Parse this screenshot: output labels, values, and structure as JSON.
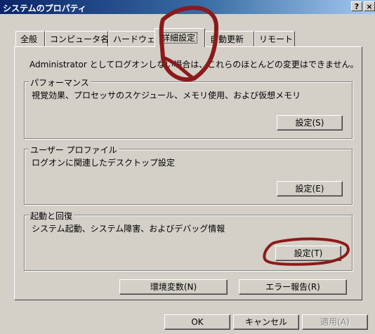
{
  "window": {
    "title": "システムのプロパティ",
    "help_label": "?",
    "close_label": "×"
  },
  "tabs": [
    {
      "label": "全般",
      "active": false
    },
    {
      "label": "コンピュータ名",
      "active": false
    },
    {
      "label": "ハードウェア",
      "active": false
    },
    {
      "label": "詳細設定",
      "active": true
    },
    {
      "label": "自動更新",
      "active": false
    },
    {
      "label": "リモート",
      "active": false
    }
  ],
  "notice": "Administrator としてログオンしない場合は、これらのほとんどの変更はできません。",
  "groups": {
    "performance": {
      "title": "パフォーマンス",
      "description": "視覚効果、プロセッサのスケジュール、メモリ使用、および仮想メモリ",
      "button_label": "設定(S)"
    },
    "user_profile": {
      "title": "ユーザー プロファイル",
      "description": "ログオンに関連したデスクトップ設定",
      "button_label": "設定(E)"
    },
    "startup_recovery": {
      "title": "起動と回復",
      "description": "システム起動、システム障害、およびデバッグ情報",
      "button_label": "設定(T)"
    }
  },
  "buttons": {
    "env_vars": "環境変数(N)",
    "error_report": "エラー報告(R)",
    "ok": "OK",
    "cancel": "キャンセル",
    "apply": "適用(A)"
  },
  "colors": {
    "dialog_bg": "#d4d0c8",
    "title_bar": "#0a246a",
    "annotation": "#8b1a1a"
  }
}
